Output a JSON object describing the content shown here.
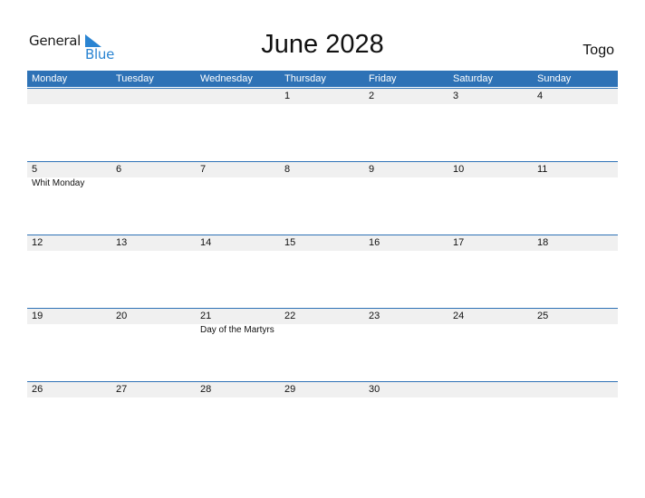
{
  "logo": {
    "general": "General",
    "blue": "Blue",
    "icon": "triangle-flag-icon",
    "color": "#2a84d2"
  },
  "title": "June 2028",
  "country": "Togo",
  "colors": {
    "header_bg": "#2e72b6",
    "strip_bg": "#f0f0f0"
  },
  "weekdays": [
    "Monday",
    "Tuesday",
    "Wednesday",
    "Thursday",
    "Friday",
    "Saturday",
    "Sunday"
  ],
  "weeks": [
    {
      "days": [
        {
          "num": "",
          "event": ""
        },
        {
          "num": "",
          "event": ""
        },
        {
          "num": "",
          "event": ""
        },
        {
          "num": "1",
          "event": ""
        },
        {
          "num": "2",
          "event": ""
        },
        {
          "num": "3",
          "event": ""
        },
        {
          "num": "4",
          "event": ""
        }
      ]
    },
    {
      "days": [
        {
          "num": "5",
          "event": "Whit Monday"
        },
        {
          "num": "6",
          "event": ""
        },
        {
          "num": "7",
          "event": ""
        },
        {
          "num": "8",
          "event": ""
        },
        {
          "num": "9",
          "event": ""
        },
        {
          "num": "10",
          "event": ""
        },
        {
          "num": "11",
          "event": ""
        }
      ]
    },
    {
      "days": [
        {
          "num": "12",
          "event": ""
        },
        {
          "num": "13",
          "event": ""
        },
        {
          "num": "14",
          "event": ""
        },
        {
          "num": "15",
          "event": ""
        },
        {
          "num": "16",
          "event": ""
        },
        {
          "num": "17",
          "event": ""
        },
        {
          "num": "18",
          "event": ""
        }
      ]
    },
    {
      "days": [
        {
          "num": "19",
          "event": ""
        },
        {
          "num": "20",
          "event": ""
        },
        {
          "num": "21",
          "event": "Day of the Martyrs"
        },
        {
          "num": "22",
          "event": ""
        },
        {
          "num": "23",
          "event": ""
        },
        {
          "num": "24",
          "event": ""
        },
        {
          "num": "25",
          "event": ""
        }
      ]
    },
    {
      "days": [
        {
          "num": "26",
          "event": ""
        },
        {
          "num": "27",
          "event": ""
        },
        {
          "num": "28",
          "event": ""
        },
        {
          "num": "29",
          "event": ""
        },
        {
          "num": "30",
          "event": ""
        },
        {
          "num": "",
          "event": ""
        },
        {
          "num": "",
          "event": ""
        }
      ]
    }
  ]
}
